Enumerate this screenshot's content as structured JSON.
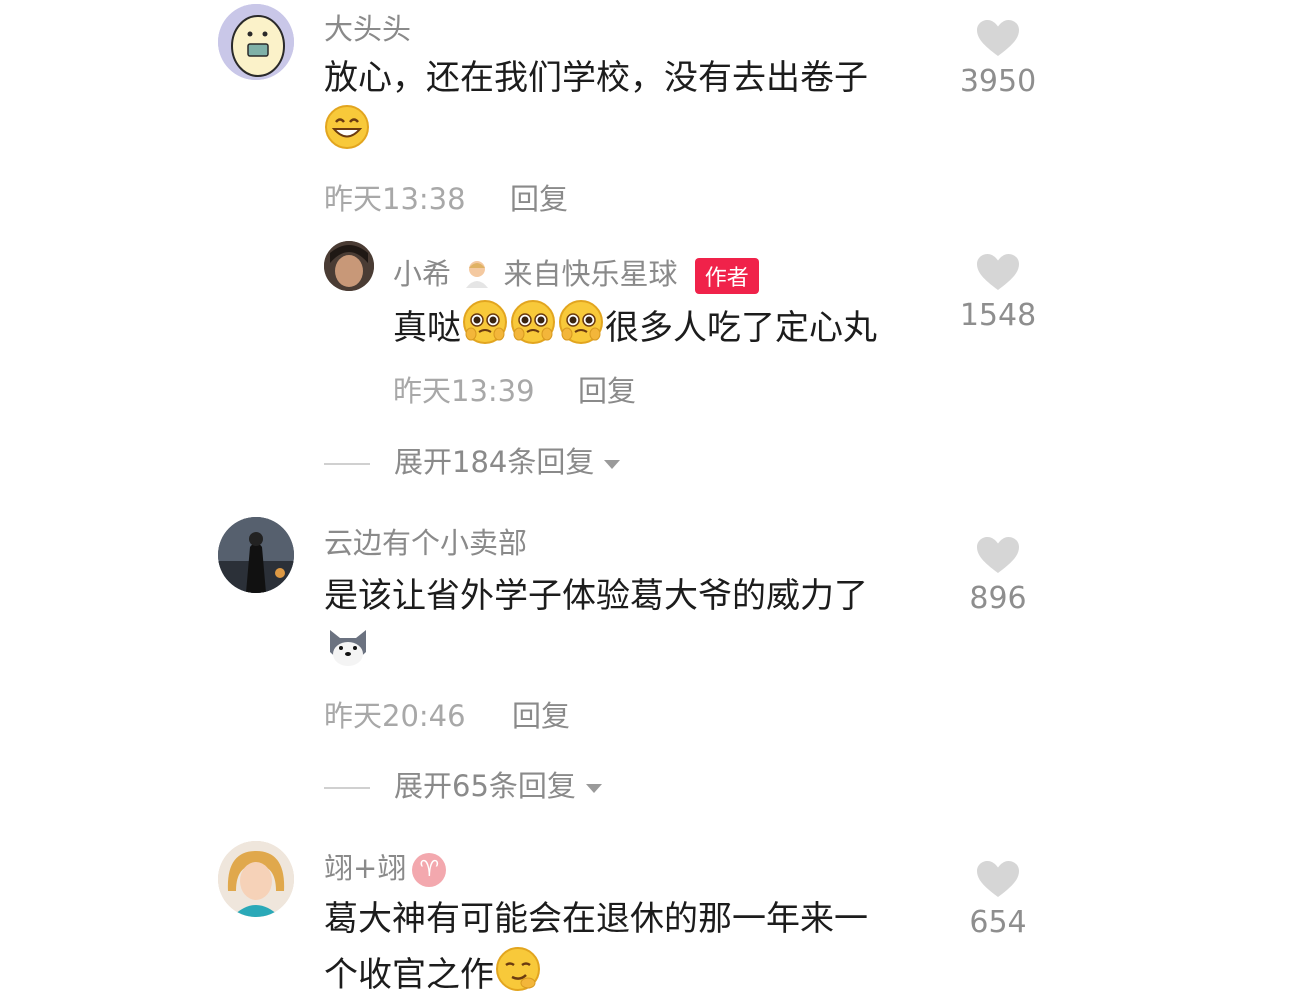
{
  "comments": [
    {
      "username": "大头头",
      "text_line1": "放心，还在我们学校，没有去出卷子",
      "time": "昨天13:38",
      "reply": "回复",
      "likes": "3950",
      "emoji": "grinning-emoji"
    },
    {
      "username_part1": "小希",
      "username_part2": "来自快乐星球",
      "badge": "作者",
      "text_start": "真哒",
      "text_end": "很多人吃了定心丸",
      "time": "昨天13:39",
      "reply": "回复",
      "likes": "1548",
      "emoji": "pleading-emoji"
    },
    {
      "username": "云边有个小卖部",
      "text_line1": "是该让省外学子体验葛大爷的威力了",
      "time": "昨天20:46",
      "reply": "回复",
      "likes": "896",
      "emoji": "husky-dog-emoji"
    },
    {
      "username": "翊+翊",
      "text_line1": "葛大神有可能会在退休的那一年来一",
      "text_line2": "个收官之作",
      "likes": "654",
      "emoji": "smirk-emoji",
      "zodiac": "♈"
    }
  ],
  "expanders": [
    {
      "label": "展开184条回复"
    },
    {
      "label": "展开65条回复"
    }
  ],
  "colors": {
    "author_badge": "#f0224a",
    "heart": "#d6d6d6"
  }
}
